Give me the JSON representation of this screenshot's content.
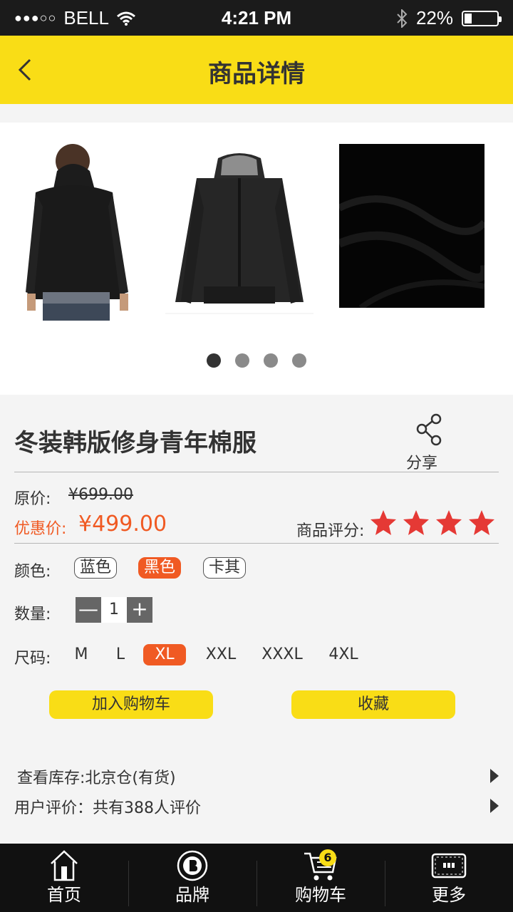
{
  "status_bar": {
    "carrier": "BELL",
    "signal_dots": "●●●○○",
    "time": "4:21 PM",
    "battery": "22%",
    "battery_level": 0.22
  },
  "header": {
    "title": "商品详情"
  },
  "gallery": {
    "slide_count": 4,
    "active_index": 0
  },
  "product": {
    "title": "冬装韩版修身青年棉服",
    "share_label": "分享",
    "original_price_label": "原价:",
    "original_price": "¥699.00",
    "sale_price_label": "优惠价:",
    "sale_price": "¥499.00",
    "rating_label": "商品评分:",
    "rating": 4,
    "color_label": "颜色:",
    "colors": [
      "蓝色",
      "黑色",
      "卡其"
    ],
    "selected_color": "黑色",
    "quantity_label": "数量:",
    "quantity": "1",
    "size_label": "尺码:",
    "sizes": [
      "M",
      "L",
      "XL",
      "XXL",
      "XXXL",
      "4XL"
    ],
    "selected_size": "XL",
    "add_to_cart": "加入购物车",
    "favorite": "收藏",
    "stock_text": "查看库存:北京仓(有货)",
    "review_text": "用户评价：共有388人评价"
  },
  "tabbar": {
    "tabs": [
      {
        "label": "首页",
        "icon": "home-icon"
      },
      {
        "label": "品牌",
        "icon": "brand-icon"
      },
      {
        "label": "购物车",
        "icon": "cart-icon"
      },
      {
        "label": "更多",
        "icon": "more-icon"
      }
    ],
    "cart_badge": "6"
  },
  "colors": {
    "accent_yellow": "#f9dd16",
    "accent_orange": "#f05a23",
    "star_red": "#e53935"
  }
}
